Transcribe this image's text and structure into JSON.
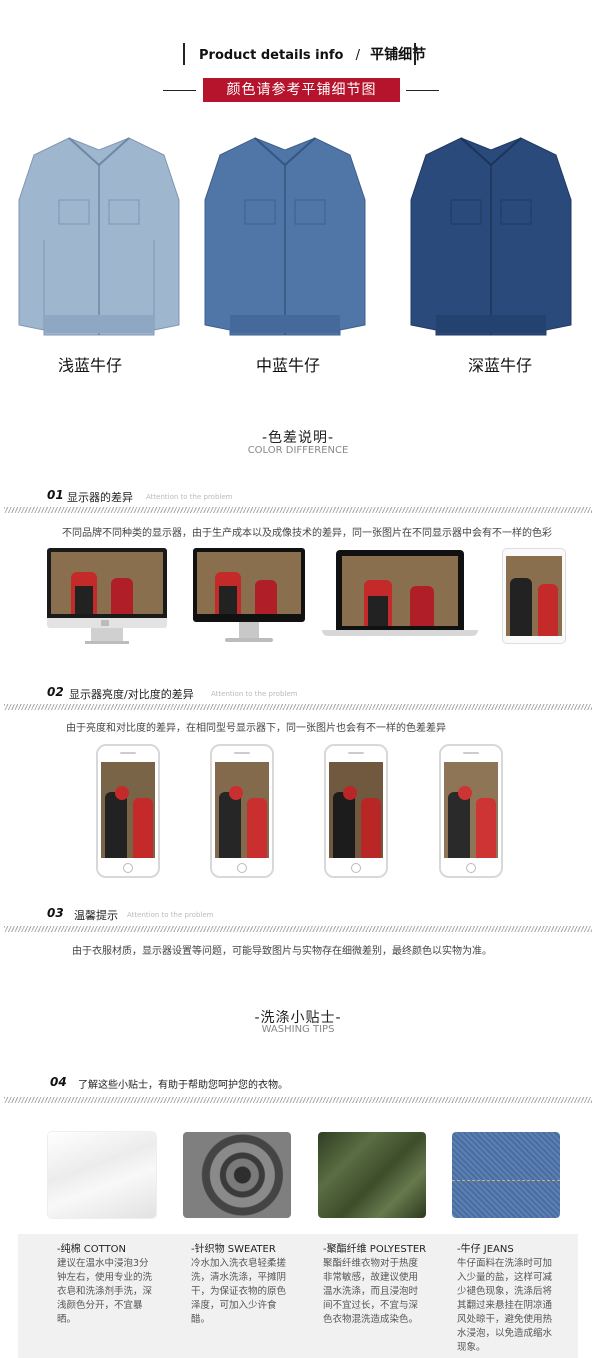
{
  "header": {
    "title_en": "Product details info",
    "separator": "/",
    "title_cn": "平铺细节",
    "banner": "颜色请参考平铺细节图"
  },
  "jackets": [
    {
      "label": "浅蓝牛仔",
      "color": "#9fb6cf"
    },
    {
      "label": "中蓝牛仔",
      "color": "#4f76a6"
    },
    {
      "label": "深蓝牛仔",
      "color": "#2a4a7c"
    }
  ],
  "color_section": {
    "title": "-色差说明-",
    "subtitle": "COLOR DIFFERENCE"
  },
  "items": [
    {
      "num": "01",
      "title": "显示器的差异",
      "en": "Attention to the problem",
      "desc": "不同品牌不同种类的显示器，由于生产成本以及成像技术的差异，同一张图片在不同显示器中会有不一样的色彩"
    },
    {
      "num": "02",
      "title": "显示器亮度/对比度的差异",
      "en": "Attention to the problem",
      "desc": "由于亮度和对比度的差异，在相同型号显示器下，同一张图片也会有不一样的色差差异"
    },
    {
      "num": "03",
      "title": "温馨提示",
      "en": "Attention to the problem",
      "desc": "由于衣服材质，显示器设置等问题，可能导致图片与实物存在细微差别，最终颜色以实物为准。"
    }
  ],
  "washing_section": {
    "title": "-洗涤小贴士-",
    "subtitle": "WASHING TIPS"
  },
  "tip": {
    "num": "04",
    "title": "了解这些小贴士，有助于帮助您呵护您的衣物。"
  },
  "fabrics": [
    {
      "title": "-纯棉 COTTON",
      "text": "建议在温水中浸泡3分钟左右，使用专业的洗衣皂和洗涤剂手洗，深浅颜色分开，不宜暴晒。",
      "color": "#f4f4f4"
    },
    {
      "title": "-针织物 SWEATER",
      "text": "冷水加入洗衣皂轻柔搓洗，清水洗涤，平摊阴干，为保证衣物的原色泽度，可加入少许食醋。",
      "color": "#6f6f6f"
    },
    {
      "title": "-聚酯纤维 POLYESTER",
      "text": "聚酯纤维衣物对于热度非常敏感，故建议使用温水洗涤，而且浸泡时间不宜过长，不宜与深色衣物混洗造成染色。",
      "color": "#4d5e3a"
    },
    {
      "title": "-牛仔 JEANS",
      "text": "牛仔面料在洗涤时可加入少量的盐，这样可减少褪色现象，洗涤后将其翻过来悬挂在阴凉通风处晾干，避免使用热水浸泡，以免造成缩水现象。",
      "color": "#4a6d9e"
    }
  ]
}
